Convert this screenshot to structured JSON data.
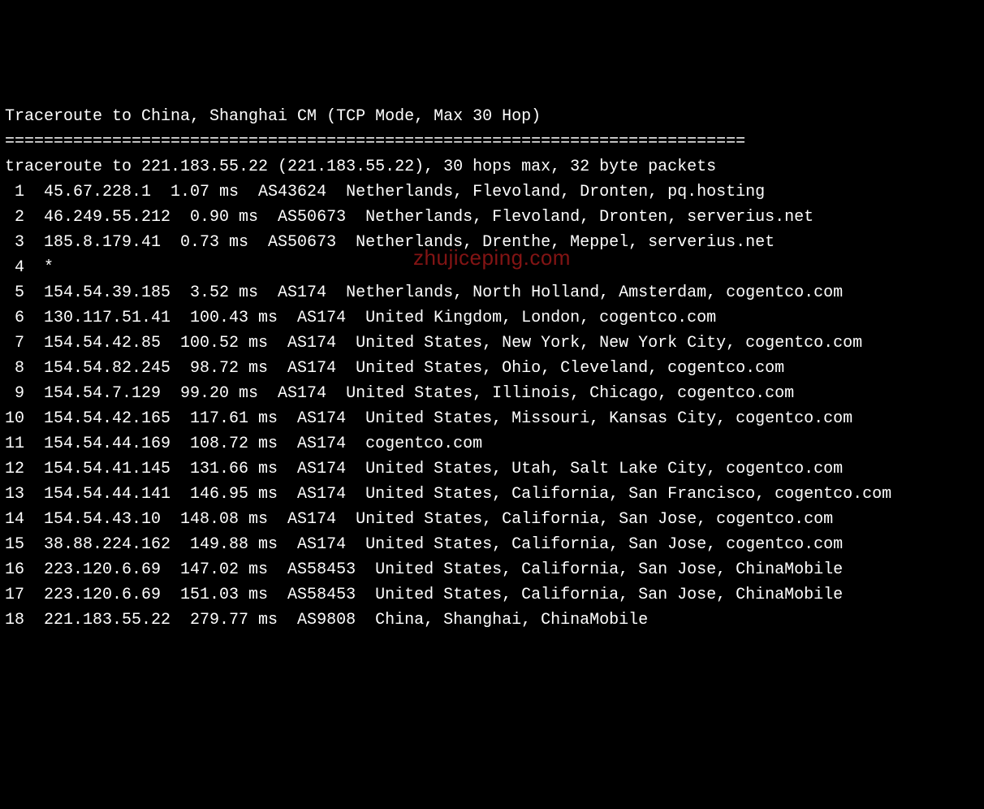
{
  "title": "Traceroute to China, Shanghai CM (TCP Mode, Max 30 Hop)",
  "divider": "============================================================================",
  "info": "traceroute to 221.183.55.22 (221.183.55.22), 30 hops max, 32 byte packets",
  "watermark": "zhujiceping.com",
  "hops": [
    {
      "num": " 1",
      "ip": "45.67.228.1",
      "ms": "1.07 ms",
      "asn": "AS43624",
      "loc": "Netherlands, Flevoland, Dronten, pq.hosting"
    },
    {
      "num": " 2",
      "ip": "46.249.55.212",
      "ms": "0.90 ms",
      "asn": "AS50673",
      "loc": "Netherlands, Flevoland, Dronten, serverius.net"
    },
    {
      "num": " 3",
      "ip": "185.8.179.41",
      "ms": "0.73 ms",
      "asn": "AS50673",
      "loc": "Netherlands, Drenthe, Meppel, serverius.net"
    },
    {
      "num": " 4",
      "ip": "*",
      "ms": "",
      "asn": "",
      "loc": ""
    },
    {
      "num": " 5",
      "ip": "154.54.39.185",
      "ms": "3.52 ms",
      "asn": "AS174",
      "loc": "Netherlands, North Holland, Amsterdam, cogentco.com"
    },
    {
      "num": " 6",
      "ip": "130.117.51.41",
      "ms": "100.43 ms",
      "asn": "AS174",
      "loc": "United Kingdom, London, cogentco.com"
    },
    {
      "num": " 7",
      "ip": "154.54.42.85",
      "ms": "100.52 ms",
      "asn": "AS174",
      "loc": "United States, New York, New York City, cogentco.com"
    },
    {
      "num": " 8",
      "ip": "154.54.82.245",
      "ms": "98.72 ms",
      "asn": "AS174",
      "loc": "United States, Ohio, Cleveland, cogentco.com"
    },
    {
      "num": " 9",
      "ip": "154.54.7.129",
      "ms": "99.20 ms",
      "asn": "AS174",
      "loc": "United States, Illinois, Chicago, cogentco.com"
    },
    {
      "num": "10",
      "ip": "154.54.42.165",
      "ms": "117.61 ms",
      "asn": "AS174",
      "loc": "United States, Missouri, Kansas City, cogentco.com"
    },
    {
      "num": "11",
      "ip": "154.54.44.169",
      "ms": "108.72 ms",
      "asn": "AS174",
      "loc": "cogentco.com"
    },
    {
      "num": "12",
      "ip": "154.54.41.145",
      "ms": "131.66 ms",
      "asn": "AS174",
      "loc": "United States, Utah, Salt Lake City, cogentco.com"
    },
    {
      "num": "13",
      "ip": "154.54.44.141",
      "ms": "146.95 ms",
      "asn": "AS174",
      "loc": "United States, California, San Francisco, cogentco.com"
    },
    {
      "num": "14",
      "ip": "154.54.43.10",
      "ms": "148.08 ms",
      "asn": "AS174",
      "loc": "United States, California, San Jose, cogentco.com"
    },
    {
      "num": "15",
      "ip": "38.88.224.162",
      "ms": "149.88 ms",
      "asn": "AS174",
      "loc": "United States, California, San Jose, cogentco.com"
    },
    {
      "num": "16",
      "ip": "223.120.6.69",
      "ms": "147.02 ms",
      "asn": "AS58453",
      "loc": "United States, California, San Jose, ChinaMobile"
    },
    {
      "num": "17",
      "ip": "223.120.6.69",
      "ms": "151.03 ms",
      "asn": "AS58453",
      "loc": "United States, California, San Jose, ChinaMobile"
    },
    {
      "num": "18",
      "ip": "221.183.55.22",
      "ms": "279.77 ms",
      "asn": "AS9808",
      "loc": "China, Shanghai, ChinaMobile"
    }
  ]
}
